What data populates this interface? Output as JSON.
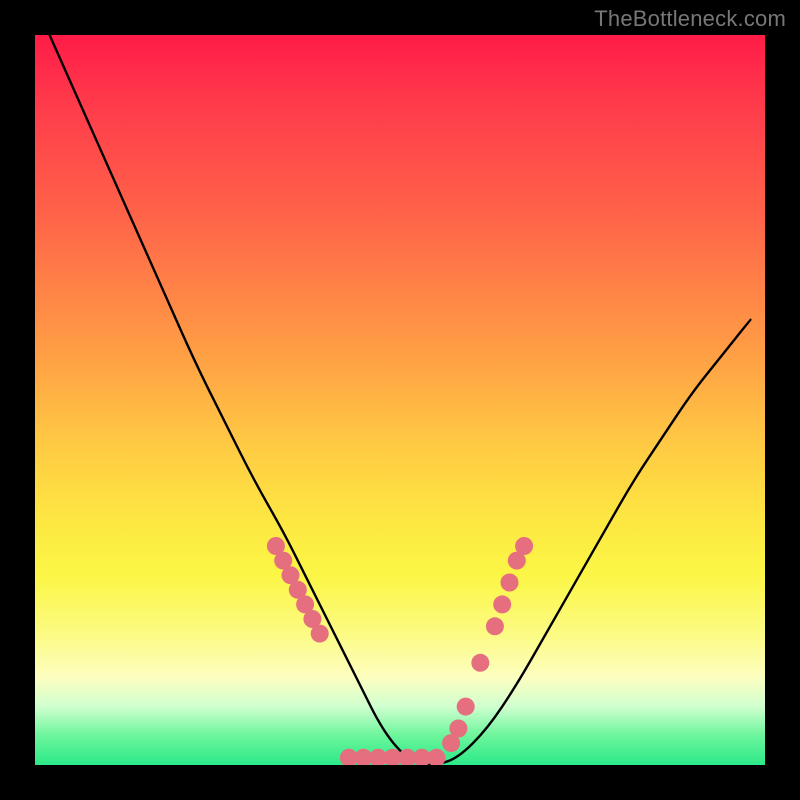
{
  "watermark": "TheBottleneck.com",
  "chart_data": {
    "type": "line",
    "title": "",
    "xlabel": "",
    "ylabel": "",
    "xlim": [
      0,
      100
    ],
    "ylim": [
      0,
      100
    ],
    "grid": false,
    "legend": false,
    "series": [
      {
        "name": "curve",
        "color": "#000000",
        "x": [
          2,
          6,
          10,
          14,
          18,
          22,
          26,
          30,
          34,
          37,
          39,
          41,
          43,
          45,
          47,
          49,
          51,
          53,
          55,
          58,
          62,
          66,
          70,
          74,
          78,
          82,
          86,
          90,
          94,
          98
        ],
        "values": [
          100,
          91,
          82,
          73,
          64,
          55,
          47,
          39,
          32,
          26,
          22,
          18,
          14,
          10,
          6,
          3,
          1,
          0,
          0,
          1,
          5,
          11,
          18,
          25,
          32,
          39,
          45,
          51,
          56,
          61
        ]
      }
    ],
    "markers": {
      "color": "#e56f7f",
      "radius_px": 9,
      "points_x": [
        33,
        34,
        35,
        36,
        37,
        38,
        39,
        43,
        45,
        47,
        49,
        51,
        53,
        55,
        57,
        58,
        59,
        61,
        63,
        64,
        65,
        66,
        67
      ],
      "points_values": [
        30,
        28,
        26,
        24,
        22,
        20,
        18,
        1,
        1,
        1,
        1,
        1,
        1,
        1,
        3,
        5,
        8,
        14,
        19,
        22,
        25,
        28,
        30
      ]
    },
    "background_gradient": {
      "stops": [
        {
          "pos": 0.0,
          "color": "#ff1c48"
        },
        {
          "pos": 0.1,
          "color": "#ff3c4b"
        },
        {
          "pos": 0.25,
          "color": "#ff6449"
        },
        {
          "pos": 0.42,
          "color": "#ff9945"
        },
        {
          "pos": 0.56,
          "color": "#ffc943"
        },
        {
          "pos": 0.66,
          "color": "#fde642"
        },
        {
          "pos": 0.74,
          "color": "#fbf645"
        },
        {
          "pos": 0.82,
          "color": "#fcfb83"
        },
        {
          "pos": 0.88,
          "color": "#fdfec0"
        },
        {
          "pos": 0.92,
          "color": "#cfffcf"
        },
        {
          "pos": 0.96,
          "color": "#6cf59b"
        },
        {
          "pos": 1.0,
          "color": "#2be989"
        }
      ]
    }
  }
}
